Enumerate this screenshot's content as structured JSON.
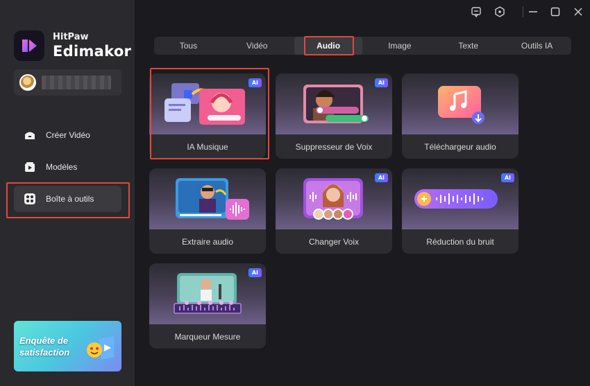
{
  "app": {
    "brand_top": "HitPaw",
    "brand_main": "Edimakor"
  },
  "sidebar": {
    "items": [
      {
        "label": "Créer Vidéo",
        "icon": "create-video-icon"
      },
      {
        "label": "Modèles",
        "icon": "templates-icon"
      },
      {
        "label": "Boîte à outils",
        "icon": "toolbox-icon",
        "active": true
      }
    ],
    "promo_text": "Enquête de satisfaction"
  },
  "tabs": [
    {
      "label": "Tous"
    },
    {
      "label": "Vidéo"
    },
    {
      "label": "Audio",
      "active": true
    },
    {
      "label": "Image"
    },
    {
      "label": "Texte"
    },
    {
      "label": "Outils IA"
    }
  ],
  "tools": [
    {
      "label": "IA Musique",
      "ai": "AI",
      "icon": "ai-music-icon"
    },
    {
      "label": "Suppresseur de Voix",
      "ai": "AI",
      "icon": "vocal-remover-icon"
    },
    {
      "label": "Téléchargeur audio",
      "icon": "audio-downloader-icon"
    },
    {
      "label": "Extraire audio",
      "icon": "extract-audio-icon"
    },
    {
      "label": "Changer Voix",
      "ai": "AI",
      "icon": "voice-changer-icon"
    },
    {
      "label": "Réduction du bruit",
      "ai": "AI",
      "icon": "noise-reduction-icon"
    },
    {
      "label": "Marqueur Mesure",
      "ai": "AI",
      "icon": "beat-marker-icon"
    }
  ],
  "colors": {
    "accent_red": "#e0483e",
    "ai_badge_start": "#3b7cff",
    "ai_badge_end": "#7b5cff",
    "sidebar_bg": "#2a2a2e",
    "main_bg": "#1b1b1f"
  }
}
